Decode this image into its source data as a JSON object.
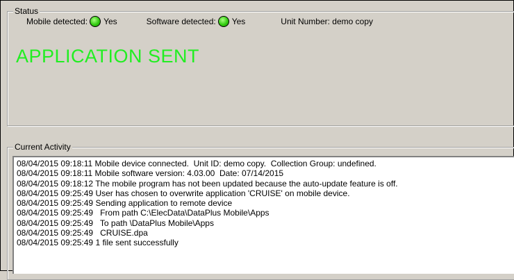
{
  "status": {
    "group_label": "Status",
    "mobile_detected_label": "Mobile detected:",
    "mobile_detected_value": "Yes",
    "software_detected_label": "Software detected:",
    "software_detected_value": "Yes",
    "unit_number_label": "Unit Number: demo copy",
    "message": "APPLICATION SENT",
    "indicator_color": "#33cc11",
    "message_color": "#22ee22"
  },
  "activity": {
    "group_label": "Current Activity",
    "lines": [
      "08/04/2015 09:18:11 Mobile device connected.  Unit ID: demo copy.  Collection Group: undefined.",
      "08/04/2015 09:18:11 Mobile software version: 4.03.00  Date: 07/14/2015",
      "08/04/2015 09:18:12 The mobile program has not been updated because the auto-update feature is off.",
      "08/04/2015 09:25:49 User has chosen to overwrite application 'CRUISE' on mobile device.",
      "08/04/2015 09:25:49 Sending application to remote device",
      "08/04/2015 09:25:49   From path C:\\ElecData\\DataPlus Mobile\\Apps",
      "08/04/2015 09:25:49   To path \\DataPlus Mobile\\Apps",
      "08/04/2015 09:25:49   CRUISE.dpa",
      "08/04/2015 09:25:49 1 file sent successfully"
    ]
  }
}
